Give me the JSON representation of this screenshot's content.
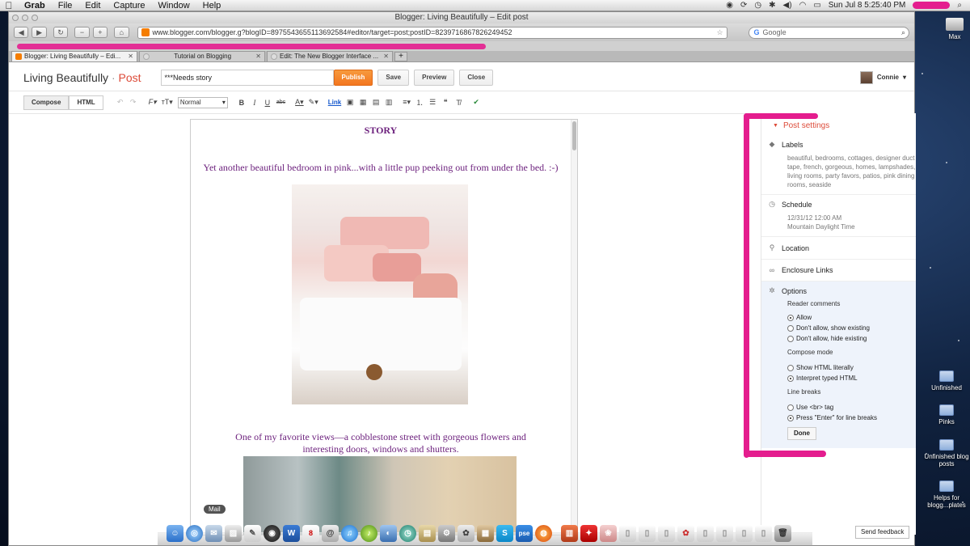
{
  "menubar": {
    "app": "Grab",
    "items": [
      "File",
      "Edit",
      "Capture",
      "Window",
      "Help"
    ],
    "clock": "Sun Jul 8  5:25:40 PM"
  },
  "window": {
    "title": "Blogger: Living Beautifully – Edit post",
    "url": "www.blogger.com/blogger.g?blogID=8975543655113692584#editor/target=post;postID=8239716867826249452",
    "search_placeholder": "Google",
    "nav": {
      "back": "◀",
      "forward": "▶",
      "reload": "↻",
      "minus": "−",
      "plus": "+",
      "home": "⌂"
    }
  },
  "tabs": [
    {
      "label": "Blogger: Living Beautifully – Edi..."
    },
    {
      "label": "Tutorial on Blogging"
    },
    {
      "label": "Edit: The New Blogger Interface ..."
    }
  ],
  "header": {
    "blog_name": "Living Beautifully",
    "separator": "·",
    "post_word": "Post",
    "post_title": "***Needs story",
    "publish": "Publish",
    "save": "Save",
    "preview": "Preview",
    "close": "Close",
    "user": "Connie"
  },
  "format_bar": {
    "compose": "Compose",
    "html": "HTML",
    "font_size": "Normal",
    "link": "Link"
  },
  "editor": {
    "heading": "STORY",
    "caption1": "Yet another beautiful bedroom in pink...with a little pup peeking out from under the bed. :-)",
    "caption2": "One of my favorite views—a cobblestone street with gorgeous flowers and interesting doors, windows and shutters."
  },
  "sidebar": {
    "title": "Post settings",
    "labels_title": "Labels",
    "labels_value": "beautiful, bedrooms, cottages, designer duct tape, french, gorgeous, homes, lampshades, living rooms, party favors, patios, pink dining rooms, seaside",
    "schedule_title": "Schedule",
    "schedule_date": "12/31/12 12:00 AM",
    "schedule_tz": "Mountain Daylight Time",
    "location_title": "Location",
    "enclosure_title": "Enclosure Links",
    "options_title": "Options",
    "reader_comments": "Reader comments",
    "rc_options": [
      "Allow",
      "Don't allow, show existing",
      "Don't allow, hide existing"
    ],
    "compose_mode": "Compose mode",
    "cm_options": [
      "Show HTML literally",
      "Interpret typed HTML"
    ],
    "line_breaks": "Line breaks",
    "lb_options": [
      "Use <br> tag",
      "Press \"Enter\" for line breaks"
    ],
    "done": "Done"
  },
  "desktop": {
    "icons": [
      {
        "label": "Max"
      },
      {
        "label": "Unfinished"
      },
      {
        "label": "Pinks"
      },
      {
        "label": "Unfinished blog posts"
      },
      {
        "label": "Helps for blogg...plates"
      }
    ]
  },
  "dock": {
    "tooltip": "Mail",
    "pse": "pse"
  },
  "feedback": "Send feedback",
  "colors": {
    "accent": "#dd4b39",
    "publish": "#f3761f",
    "annotation": "#e41d8e",
    "caption": "#6b1f7c"
  }
}
